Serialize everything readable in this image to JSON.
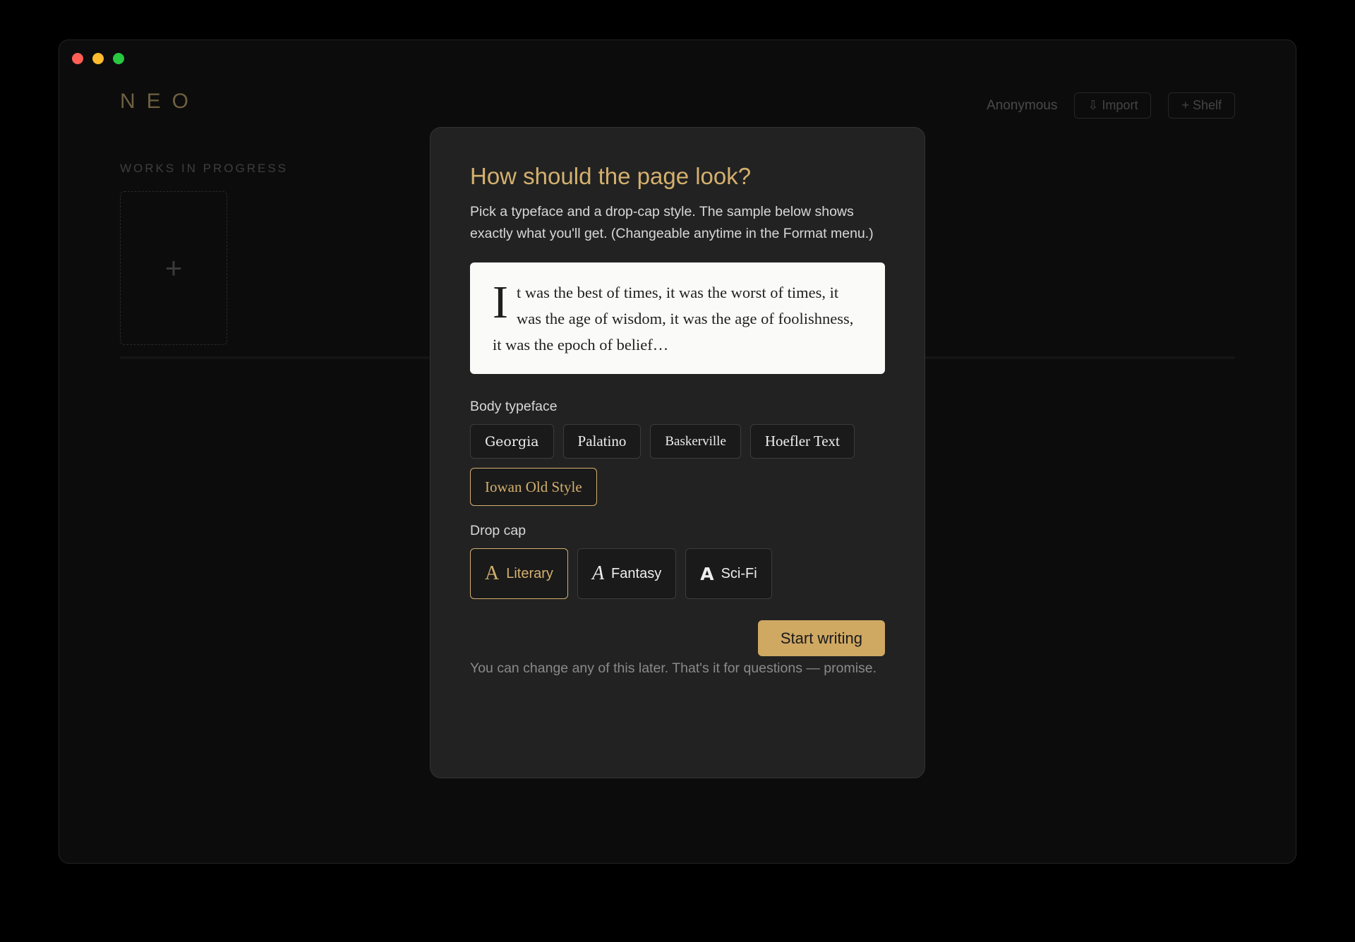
{
  "app": {
    "logo": "NEO",
    "user": "Anonymous",
    "import_label": "⇩ Import",
    "shelf_label": "+ Shelf",
    "section_title": "WORKS IN PROGRESS",
    "add_card_icon": "+"
  },
  "modal": {
    "title": "How should the page look?",
    "description": "Pick a typeface and a drop-cap style. The sample below shows exactly what you'll get. (Changeable anytime in the Format menu.)",
    "sample": {
      "drop_cap": "I",
      "text": "t was the best of times, it was the worst of times, it was the age of wisdom, it was the age of foolishness, it was the epoch of belief…"
    },
    "typeface_label": "Body typeface",
    "typefaces": [
      {
        "label": "Georgia",
        "selected": false
      },
      {
        "label": "Palatino",
        "selected": false
      },
      {
        "label": "Baskerville",
        "selected": false
      },
      {
        "label": "Hoefler Text",
        "selected": false
      },
      {
        "label": "Iowan Old Style",
        "selected": true
      }
    ],
    "dropcap_label": "Drop cap",
    "dropcaps": [
      {
        "glyph": "A",
        "label": "Literary",
        "selected": true
      },
      {
        "glyph": "A",
        "label": "Fantasy",
        "selected": false
      },
      {
        "glyph": "A",
        "label": "Sci-Fi",
        "selected": false
      }
    ],
    "start_label": "Start writing",
    "footnote": "You can change any of this later. That's it for questions — promise."
  },
  "colors": {
    "accent": "#d4b06e",
    "button": "#cfa862"
  }
}
